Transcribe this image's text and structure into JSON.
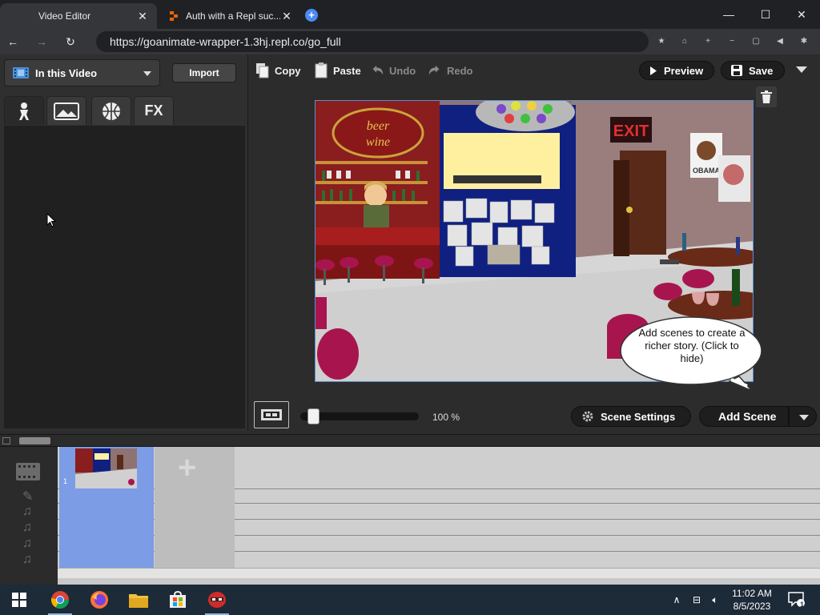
{
  "browser": {
    "tabs": [
      {
        "title": "Video Editor",
        "active": true
      },
      {
        "title": "Auth with a Repl suc...",
        "active": false
      }
    ],
    "url": "https://goanimate-wrapper-1.3hj.repl.co/go_full"
  },
  "left_panel": {
    "source_dropdown": "In this Video",
    "import_label": "Import",
    "asset_tabs": [
      {
        "icon": "character-icon",
        "active": true
      },
      {
        "icon": "background-icon",
        "active": false
      },
      {
        "icon": "prop-icon",
        "active": false
      },
      {
        "icon": "fx-icon",
        "label": "FX",
        "active": false
      }
    ]
  },
  "stage_toolbar": {
    "copy": "Copy",
    "paste": "Paste",
    "undo": "Undo",
    "redo": "Redo",
    "preview": "Preview",
    "save": "Save"
  },
  "stage": {
    "scene": {
      "bar_sign": "beer wine",
      "exit_sign": "EXIT",
      "poster": "OBAMA"
    },
    "tip_bubble": "Add scenes to create a richer story. (Click to hide)"
  },
  "stage_bottom": {
    "zoom": "100 %",
    "scene_settings": "Scene Settings",
    "add_scene": "Add Scene"
  },
  "timeline": {
    "scenes": [
      {
        "number": "1"
      }
    ],
    "tracks": [
      "scene-icon",
      "pen-icon",
      "music-note-icon",
      "music-note-icon",
      "music-note-icon",
      "music-note-icon"
    ]
  },
  "taskbar": {
    "time": "11:02 AM",
    "date": "8/5/2023",
    "notification_count": "1"
  },
  "colors": {
    "accent": "#5d8fcf",
    "timeline_scene": "#7c9ce6",
    "panel_bg": "#2f2f2f"
  }
}
